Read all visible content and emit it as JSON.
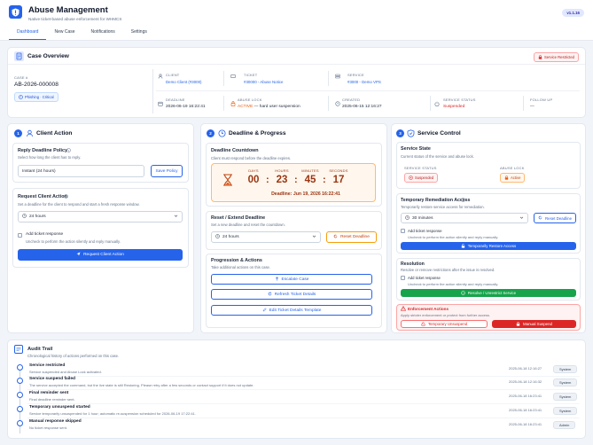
{
  "header": {
    "title": "Abuse Management",
    "subtitle": "Native ticket-based abuse enforcement for WHMCS",
    "version": "v1.1.16",
    "tabs": [
      "Dashboard",
      "New Case",
      "Notifications",
      "Settings"
    ]
  },
  "overview": {
    "title": "Case Overview",
    "restricted_badge": "Service Restricted",
    "case_label": "CASE #",
    "case_number": "AB-2026-000008",
    "case_type": "Phishing · Critical",
    "client_label": "CLIENT",
    "client_value": "Demo Client (#3000)",
    "ticket_label": "TICKET",
    "ticket_value": "#30000 - Abuse Notice",
    "service_label": "SERVICE",
    "service_value": "#3000 - Demo VPS",
    "deadline_label": "DEADLINE",
    "deadline_value": "2026-06-19 16:22:41",
    "lock_label": "ABUSE LOCK",
    "lock_active": "ACTIVE",
    "lock_rest": " — hard user suspension",
    "created_label": "CREATED",
    "created_value": "2025-06-15 12:16:27",
    "status_label": "SERVICE STATUS",
    "status_value": "Suspended",
    "followup_label": "FOLLOW UP",
    "followup_value": "—"
  },
  "client_action": {
    "num": "1",
    "title": "Client Action",
    "reply_policy_title": "Reply Deadline Policy",
    "reply_policy_desc": "Select how long the client has to reply.",
    "reply_policy_value": "Instant (24 hours)",
    "save_policy": "Save Policy",
    "request_title": "Request Client Action",
    "request_desc": "Set a deadline for the client to respond and start a fresh response window.",
    "request_value": "24 hours",
    "add_ticket_label": "Add ticket response",
    "add_ticket_desc": "Uncheck to perform the action silently and reply manually.",
    "request_button": "Request Client Action"
  },
  "deadline": {
    "num": "2",
    "title": "Deadline & Progress",
    "countdown_title": "Deadline Countdown",
    "countdown_desc": "Client must respond before the deadline expires.",
    "days_label": "DAYS",
    "hours_label": "HOURS",
    "minutes_label": "MINUTES",
    "seconds_label": "SECONDS",
    "days": "00",
    "hours": "23",
    "minutes": "45",
    "seconds": "17",
    "deadline_text": "Deadline: Jun 19, 2026 16:22:41",
    "reset_title": "Reset / Extend Deadline",
    "reset_desc": "Set a new deadline and reset the countdown.",
    "reset_value": "24 hours",
    "reset_button": "Reset Deadline",
    "progression_title": "Progression & Actions",
    "progression_desc": "Take additional actions on this case.",
    "escalate": "Escalate Case",
    "refresh": "Refresh Ticket Details",
    "edit_template": "Edit Ticket Details Template"
  },
  "service": {
    "num": "3",
    "title": "Service Control",
    "state_title": "Service State",
    "state_desc": "Current status of the service and abuse lock.",
    "status_label": "SERVICE STATUS",
    "status_value": "Suspended",
    "lock_label": "ABUSE LOCK",
    "lock_value": "Active",
    "remediation_title": "Temporary Remediation Access",
    "remediation_desc": "Temporarily restore service access for remediation.",
    "remediation_value": "30 minutes",
    "reset_deadline": "Reset Deadline",
    "add_ticket_label": "Add ticket response",
    "add_ticket_desc": "Uncheck to perform the action silently and reply manually.",
    "restore_button": "Temporarily Restore Access",
    "resolution_title": "Resolution",
    "resolution_desc": "Resolve or remove restrictions after the issue is resolved.",
    "resolve_button": "Resolve / Unrestrict Service",
    "enforcement_title": "Enforcement Actions",
    "enforcement_desc": "Apply stricter enforcement or protect from further access.",
    "temp_unsuspend": "Temporary Unsuspend",
    "manual_suspend": "Manual Suspend"
  },
  "audit": {
    "title": "Audit Trail",
    "desc": "Chronological history of actions performed on this case.",
    "entries": [
      {
        "title": "Service restricted",
        "desc": "Service suspended and Abuse Lock activated.",
        "time": "2025-06-18 12:16:27",
        "actor": "System"
      },
      {
        "title": "Service suspend failed",
        "desc": "The service accepted the command, but the live state is still Restoring. Please retry after a few seconds or contact support if it does not update.",
        "time": "2025-06-18 12:16:32",
        "actor": "System"
      },
      {
        "title": "Final reminder sent",
        "desc": "Final deadline reminder sent.",
        "time": "2025-06-18 16:23:41",
        "actor": "System"
      },
      {
        "title": "Temporary unsuspend started",
        "desc": "Service temporarily unsuspended for 1 hour; automatic re-suspension scheduled for 2026-06-19 17:22:41.",
        "time": "2025-06-18 16:23:41",
        "actor": "System"
      },
      {
        "title": "Manual response skipped",
        "desc": "No ticket response sent.",
        "time": "2025-06-18 16:23:41",
        "actor": "Admin"
      }
    ]
  },
  "colors": {
    "accent": "#2563eb",
    "danger": "#dc2626",
    "success": "#16a34a",
    "warning": "#f59e0b"
  }
}
